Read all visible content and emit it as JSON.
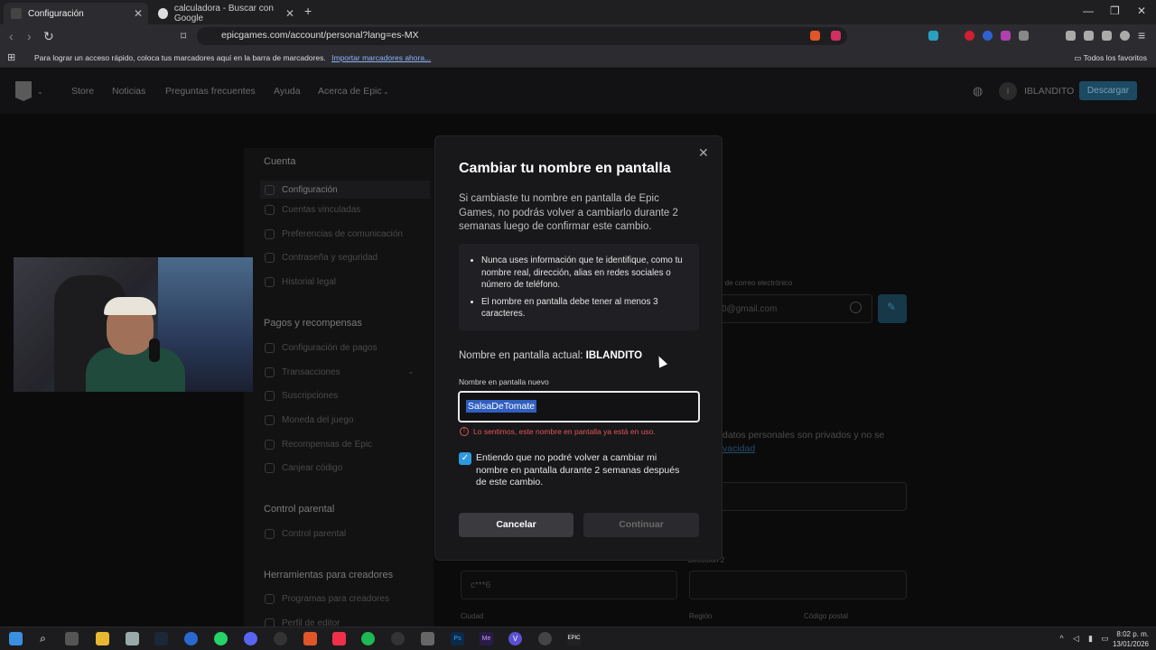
{
  "browser": {
    "tabs": [
      {
        "label": "Configuración",
        "active": true
      },
      {
        "label": "calculadora - Buscar con Google",
        "active": false
      }
    ],
    "url": "epicgames.com/account/personal?lang=es-MX",
    "bookmarks_message": "Para lograr un acceso rápido, coloca tus marcadores aquí en la barra de marcadores.",
    "bookmarks_link": "Importar marcadores ahora...",
    "all_bookmarks": "Todos los favoritos"
  },
  "site": {
    "nav": [
      "Store",
      "Noticias",
      "Preguntas frecuentes",
      "Ayuda",
      "Acerca de Epic"
    ],
    "user": "IBLANDITO",
    "user_initial": "I",
    "download_button": "Descargar",
    "sidebar": {
      "sections": [
        {
          "title": "Cuenta",
          "items": [
            "Configuración",
            "Cuentas vinculadas",
            "Preferencias de comunicación",
            "Contraseña y seguridad",
            "Historial legal"
          ]
        },
        {
          "title": "Pagos y recompensas",
          "items": [
            "Configuración de pagos",
            "Transacciones",
            "Suscripciones",
            "Moneda del juego",
            "Recompensas de Epic",
            "Canjear código"
          ]
        },
        {
          "title": "Control parental",
          "items": [
            "Control parental"
          ]
        },
        {
          "title": "Herramientas para creadores",
          "items": [
            "Programas para creadores",
            "Perfil de editor"
          ]
        }
      ]
    },
    "background": {
      "email_label": "n de correo electrónico",
      "email_value": "0@gmail.com",
      "privacy_text": "datos personales son privados y no se",
      "privacy_link": "vacidad",
      "address_value": "c***6",
      "address2_label": "Dirección 2",
      "city_label": "Ciudad",
      "region_label": "Región",
      "postal_label": "Código postal"
    }
  },
  "modal": {
    "title": "Cambiar tu nombre en pantalla",
    "description": "Si cambiaste tu nombre en pantalla de Epic Games, no podrás volver a cambiarlo durante 2 semanas luego de confirmar este cambio.",
    "rules": [
      "Nunca uses información que te identifique, como tu nombre real, dirección, alias en redes sociales o número de teléfono.",
      "El nombre en pantalla debe tener al menos 3 caracteres."
    ],
    "current_label": "Nombre en pantalla actual:",
    "current_value": "IBLANDITO",
    "new_label": "Nombre en pantalla nuevo",
    "new_value": "SalsaDeTomate",
    "error": "Lo sentimos, este nombre en pantalla ya está en uso.",
    "checkbox_checked": true,
    "checkbox_text": "Entiendo que no podré volver a cambiar mi nombre en pantalla durante 2 semanas después de este cambio.",
    "cancel": "Cancelar",
    "continue": "Continuar"
  },
  "taskbar": {
    "time": "8:02 p. m.",
    "date": "13/01/2026"
  }
}
